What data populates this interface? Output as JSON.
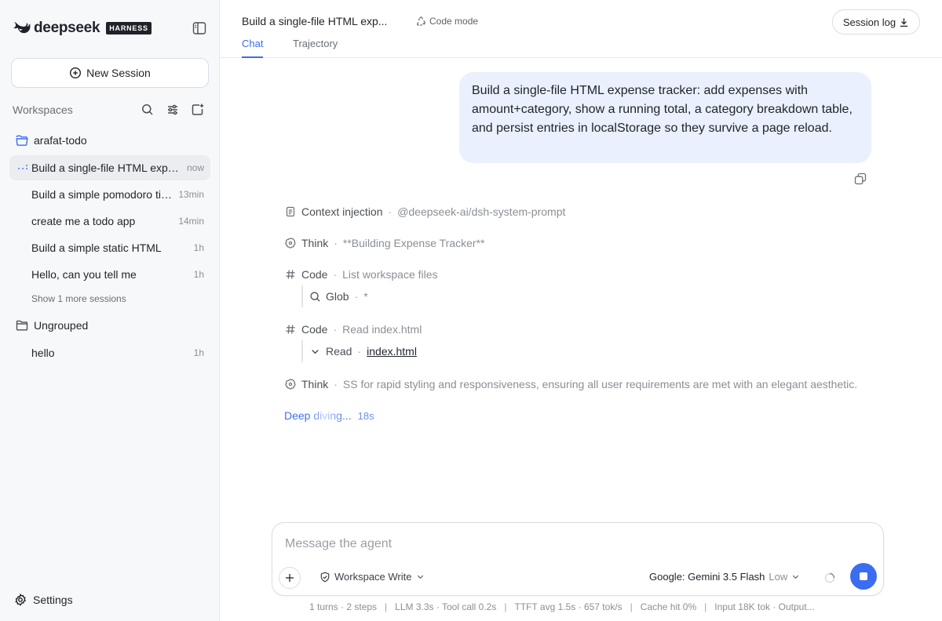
{
  "brand": {
    "name": "deepseek",
    "badge": "HARNESS"
  },
  "sidebar": {
    "new_session_label": "New Session",
    "workspaces_label": "Workspaces",
    "groups": [
      {
        "name": "arafat-todo",
        "sessions": [
          {
            "title": "Build a single-file HTML expense tracker",
            "time": "now",
            "active": true
          },
          {
            "title": "Build a simple pomodoro timer",
            "time": "13min"
          },
          {
            "title": "create me a todo app",
            "time": "14min"
          },
          {
            "title": "Build a simple static HTML",
            "time": "1h"
          },
          {
            "title": "Hello, can you tell me",
            "time": "1h"
          }
        ],
        "show_more": "Show 1 more sessions"
      },
      {
        "name": "Ungrouped",
        "sessions": [
          {
            "title": "hello",
            "time": "1h"
          }
        ]
      }
    ],
    "settings_label": "Settings"
  },
  "header": {
    "title": "Build a single-file HTML exp...",
    "mode": "Code mode",
    "tabs": [
      {
        "label": "Chat",
        "active": true
      },
      {
        "label": "Trajectory"
      }
    ],
    "session_log_label": "Session log"
  },
  "chat": {
    "user_message": "Build a single-file HTML expense tracker: add expenses with amount+category, show a running total, a category breakdown table, and persist entries in localStorage so they survive a page reload.",
    "steps": [
      {
        "icon": "document-icon",
        "label": "Context injection",
        "detail": "@deepseek-ai/dsh-system-prompt"
      },
      {
        "icon": "think-icon",
        "label": "Think",
        "detail": "**Building Expense Tracker**"
      },
      {
        "icon": "hash-icon",
        "label": "Code",
        "detail": "List workspace files",
        "sub": {
          "icon": "search-icon",
          "label": "Glob",
          "detail": "*"
        }
      },
      {
        "icon": "hash-icon",
        "label": "Code",
        "detail": "Read index.html",
        "sub": {
          "icon": "chevron-down-icon",
          "label": "Read",
          "link": "index.html"
        }
      },
      {
        "icon": "think-icon",
        "label": "Think",
        "detail": "SS for rapid styling and responsiveness, ensuring all user requirements are met with an elegant aesthetic."
      }
    ],
    "status": {
      "text": "Deep diving...",
      "elapsed": "18s"
    }
  },
  "composer": {
    "placeholder": "Message the agent",
    "permission": "Workspace Write",
    "model": "Google: Gemini 3.5 Flash",
    "reasoning_level": "Low"
  },
  "stats": {
    "turns": "1 turns · 2 steps",
    "llm": "LLM 3.3s · Tool call 0.2s",
    "ttft": "TTFT avg 1.5s · 657 tok/s",
    "cache": "Cache hit 0%",
    "tokens": "Input 18K tok · Output..."
  },
  "colors": {
    "accent": "#3b6df0",
    "bubble": "#eaf0fd",
    "sidebar_bg": "#f7f8fa",
    "active_row": "#ebedf0"
  }
}
